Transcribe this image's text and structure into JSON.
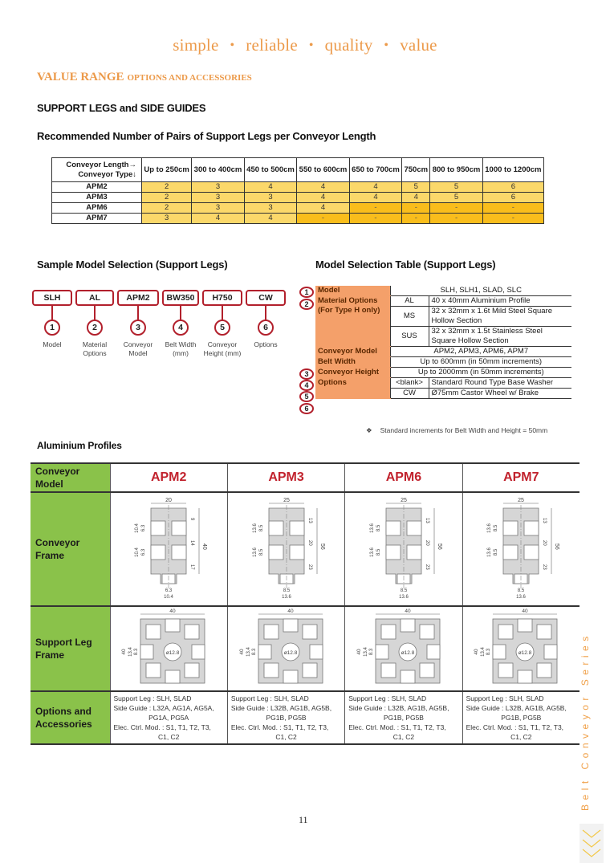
{
  "tagline": [
    "simple",
    "reliable",
    "quality",
    "value"
  ],
  "section_title": {
    "big": "VALUE RANGE",
    "small": "OPTIONS AND ACCESSORIES"
  },
  "heading_support": "SUPPORT LEGS and SIDE GUIDES",
  "heading_recommended": "Recommended Number of Pairs of Support Legs per Conveyor Length",
  "legs_table": {
    "corner_top": "Conveyor Length→",
    "corner_bottom": "Conveyor Type↓",
    "columns": [
      "Up to 250cm",
      "300 to 400cm",
      "450 to 500cm",
      "550 to 600cm",
      "650 to 700cm",
      "750cm",
      "800 to 950cm",
      "1000 to 1200cm"
    ],
    "rows": [
      {
        "type": "APM2",
        "values": [
          "2",
          "3",
          "4",
          "4",
          "4",
          "5",
          "5",
          "6"
        ]
      },
      {
        "type": "APM3",
        "values": [
          "2",
          "3",
          "3",
          "4",
          "4",
          "4",
          "5",
          "6"
        ]
      },
      {
        "type": "APM6",
        "values": [
          "2",
          "3",
          "3",
          "4",
          "-",
          "-",
          "-",
          "-"
        ]
      },
      {
        "type": "APM7",
        "values": [
          "3",
          "4",
          "4",
          "-",
          "-",
          "-",
          "-",
          "-"
        ]
      }
    ],
    "colors": {
      "value": "#fbd86a",
      "not_available": "#f9bd1c"
    }
  },
  "sample_selection": {
    "title": "Sample Model Selection (Support Legs)",
    "boxes": [
      {
        "code": "SLH",
        "num": "1",
        "label": "Model"
      },
      {
        "code": "AL",
        "num": "2",
        "label": "Material Options"
      },
      {
        "code": "APM2",
        "num": "3",
        "label": "Conveyor Model"
      },
      {
        "code": "BW350",
        "num": "4",
        "label": "Belt Width (mm)"
      },
      {
        "code": "H750",
        "num": "5",
        "label": "Conveyor Height (mm)"
      },
      {
        "code": "CW",
        "num": "6",
        "label": "Options"
      }
    ]
  },
  "selection_table": {
    "title": "Model Selection Table (Support Legs)",
    "model_label": "Model",
    "model_value": "SLH, SLH1, SLAD, SLC",
    "material_label": "Material Options",
    "material_sub": "(For Type H only)",
    "materials": [
      {
        "code": "AL",
        "desc": "40 x 40mm Aluminium Profile"
      },
      {
        "code": "MS",
        "desc": "32 x 32mm x 1.6t Mild Steel Square Hollow Section"
      },
      {
        "code": "SUS",
        "desc": "32 x 32mm x 1.5t Stainless Steel Square Hollow Section"
      }
    ],
    "conveyor_model_label": "Conveyor Model",
    "conveyor_model_value": "APM2, APM3, APM6, APM7",
    "belt_width_label": "Belt Width",
    "belt_width_value": "Up to 600mm (in 50mm increments)",
    "height_label": "Conveyor Height",
    "height_value": "Up to 2000mm (in 50mm increments)",
    "options_label": "Options",
    "options": [
      {
        "code": "<blank>",
        "desc": "Standard Round Type Base Washer"
      },
      {
        "code": "CW",
        "desc": "Ø75mm Castor Wheel w/ Brake"
      }
    ],
    "nums": [
      "1",
      "2",
      "3",
      "4",
      "5",
      "6"
    ],
    "note_bullet": "❖",
    "note": "Standard increments for Belt Width and Height  = 50mm"
  },
  "profiles": {
    "title": "Aluminium Profiles",
    "row_labels": {
      "model": "Conveyor Model",
      "frame": "Conveyor Frame",
      "leg": "Support Leg Frame",
      "options": "Options and Accessories"
    },
    "models": [
      {
        "name": "APM2",
        "frame_dims": {
          "width": "20",
          "height": "40",
          "top": "9",
          "mid": "14",
          "bottom": "17",
          "slot_outer": "10.4",
          "slot_inner": "6.3"
        },
        "options": {
          "support_leg": "Support Leg : SLH, SLAD",
          "side_guide": "Side Guide : L32A, AG1A, AG5A,",
          "side_guide_2": "PG1A, PG5A",
          "elec": "Elec. Ctrl. Mod. : S1, T1, T2, T3,",
          "elec_2": "C1, C2"
        }
      },
      {
        "name": "APM3",
        "frame_dims": {
          "width": "25",
          "height": "56",
          "top": "13",
          "mid": "20",
          "bottom": "23",
          "slot_outer": "13.6",
          "slot_inner": "8.5"
        },
        "options": {
          "support_leg": "Support Leg : SLH, SLAD",
          "side_guide": "Side Guide : L32B, AG1B, AG5B,",
          "side_guide_2": "PG1B, PG5B",
          "elec": "Elec. Ctrl. Mod. : S1, T1, T2, T3,",
          "elec_2": "C1, C2"
        }
      },
      {
        "name": "APM6",
        "frame_dims": {
          "width": "25",
          "height": "56",
          "top": "13",
          "mid": "20",
          "bottom": "23",
          "slot_outer": "13.6",
          "slot_inner": "8.5"
        },
        "options": {
          "support_leg": "Support Leg : SLH, SLAD",
          "side_guide": "Side Guide : L32B, AG1B, AG5B,",
          "side_guide_2": "PG1B, PG5B",
          "elec": "Elec. Ctrl. Mod. : S1, T1, T2, T3,",
          "elec_2": "C1, C2"
        }
      },
      {
        "name": "APM7",
        "frame_dims": {
          "width": "25",
          "height": "56",
          "top": "13",
          "mid": "20",
          "bottom": "23",
          "slot_outer": "13.6",
          "slot_inner": "8.5"
        },
        "options": {
          "support_leg": "Support Leg : SLH, SLAD",
          "side_guide": "Side Guide : L32B, AG1B, AG5B,",
          "side_guide_2": "PG1B, PG5B",
          "elec": "Elec. Ctrl. Mod. : S1, T1, T2, T3,",
          "elec_2": "C1, C2"
        }
      }
    ],
    "leg_dims": {
      "width": "40",
      "height": "40",
      "slot_outer": "13.4",
      "slot_inner": "8.3",
      "bore": "ø12.8"
    },
    "colors": {
      "label_bg": "#8ac24a",
      "model_text": "#c1222d"
    }
  },
  "page_number": "11",
  "side_text": "Belt Conveyor Series",
  "colors": {
    "accent": "#ec9a4a",
    "red": "#b2202c",
    "orange_label": "#f4a06a"
  }
}
